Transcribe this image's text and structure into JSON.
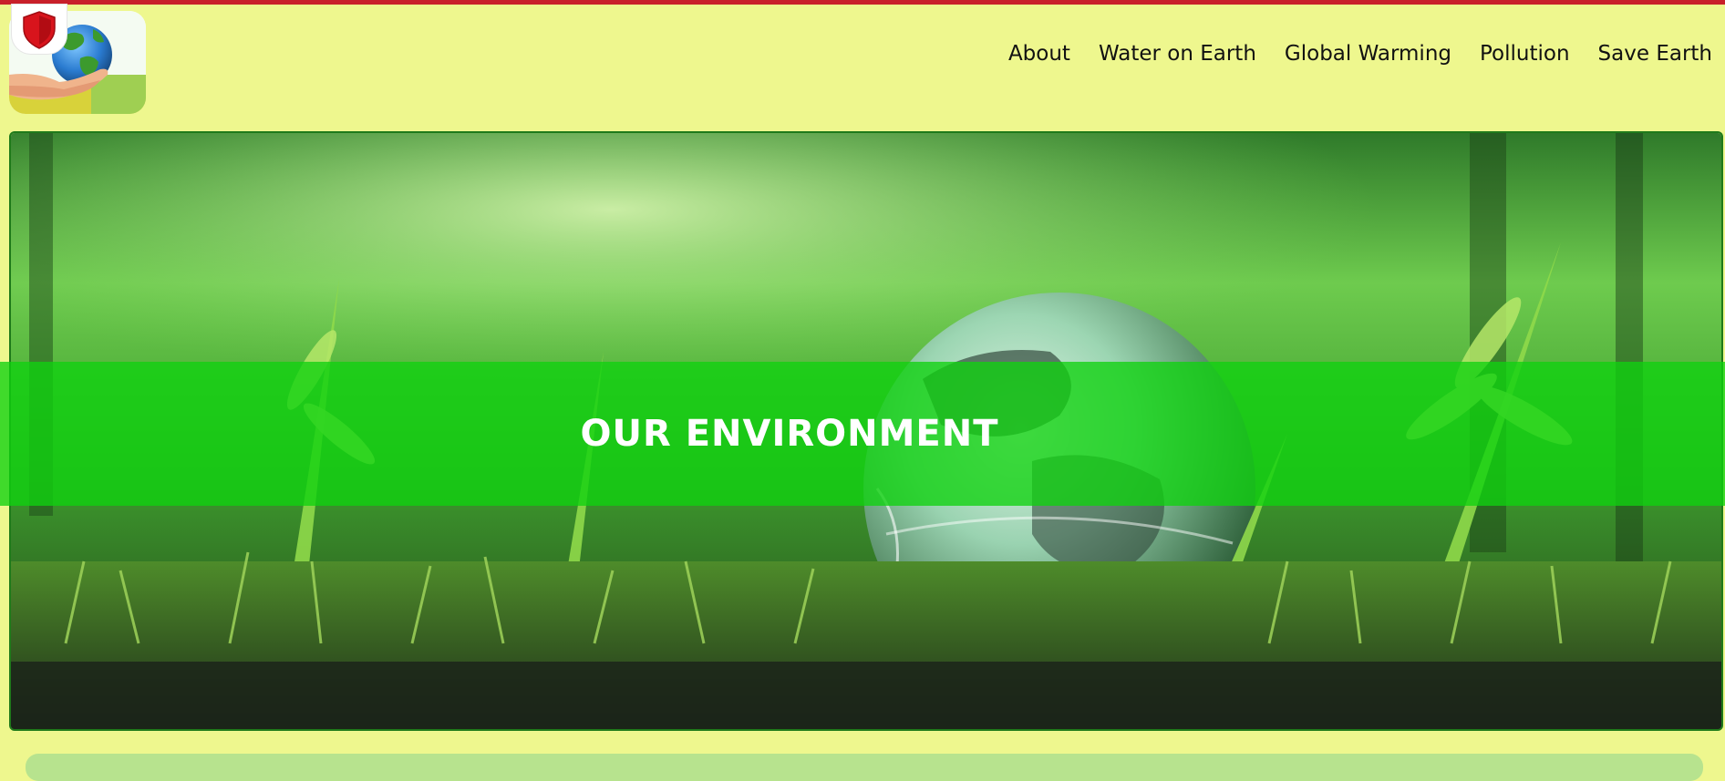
{
  "nav": {
    "items": [
      {
        "label": "About"
      },
      {
        "label": "Water on Earth"
      },
      {
        "label": "Global Warming"
      },
      {
        "label": "Pollution"
      },
      {
        "label": "Save Earth"
      }
    ]
  },
  "hero": {
    "title": "OUR ENVIRONMENT"
  },
  "icons": {
    "logo": "globe-in-hands-icon",
    "badge": "shield-icon"
  },
  "colors": {
    "page_background": "#eef78e",
    "banner_overlay": "#10d210",
    "hero_border": "#1f7a1a",
    "top_strip": "#c8202a",
    "bottom_panel": "#b7e38e"
  }
}
